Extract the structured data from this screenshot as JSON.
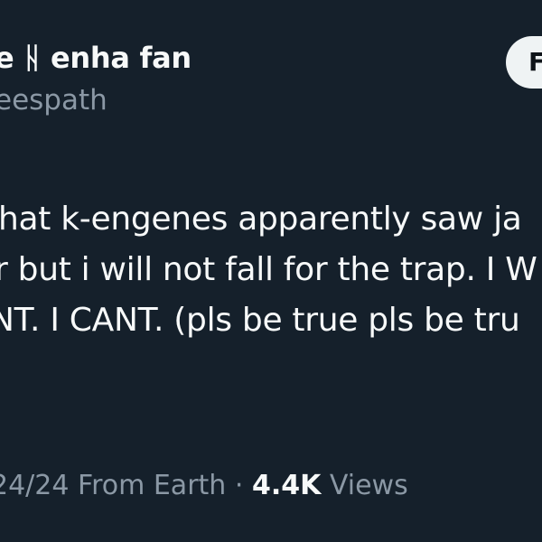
{
  "author": {
    "display_name": "e ᚺ enha fan",
    "handle": "eespath"
  },
  "follow_button": {
    "label": "Follow"
  },
  "tweet": {
    "lines": [
      "hat k-engenes apparently saw ja",
      "r but i will not fall for the trap. I W",
      "NT. I CANT. (pls be true pls be tru"
    ]
  },
  "meta": {
    "date_source": "24/24 From Earth",
    "separator": "·",
    "views_count": "4.4K",
    "views_label": "Views"
  },
  "colors": {
    "background": "#15202b",
    "text_primary": "#f7f9f9",
    "text_secondary": "#8b98a5",
    "button_bg": "#eff3f4"
  }
}
